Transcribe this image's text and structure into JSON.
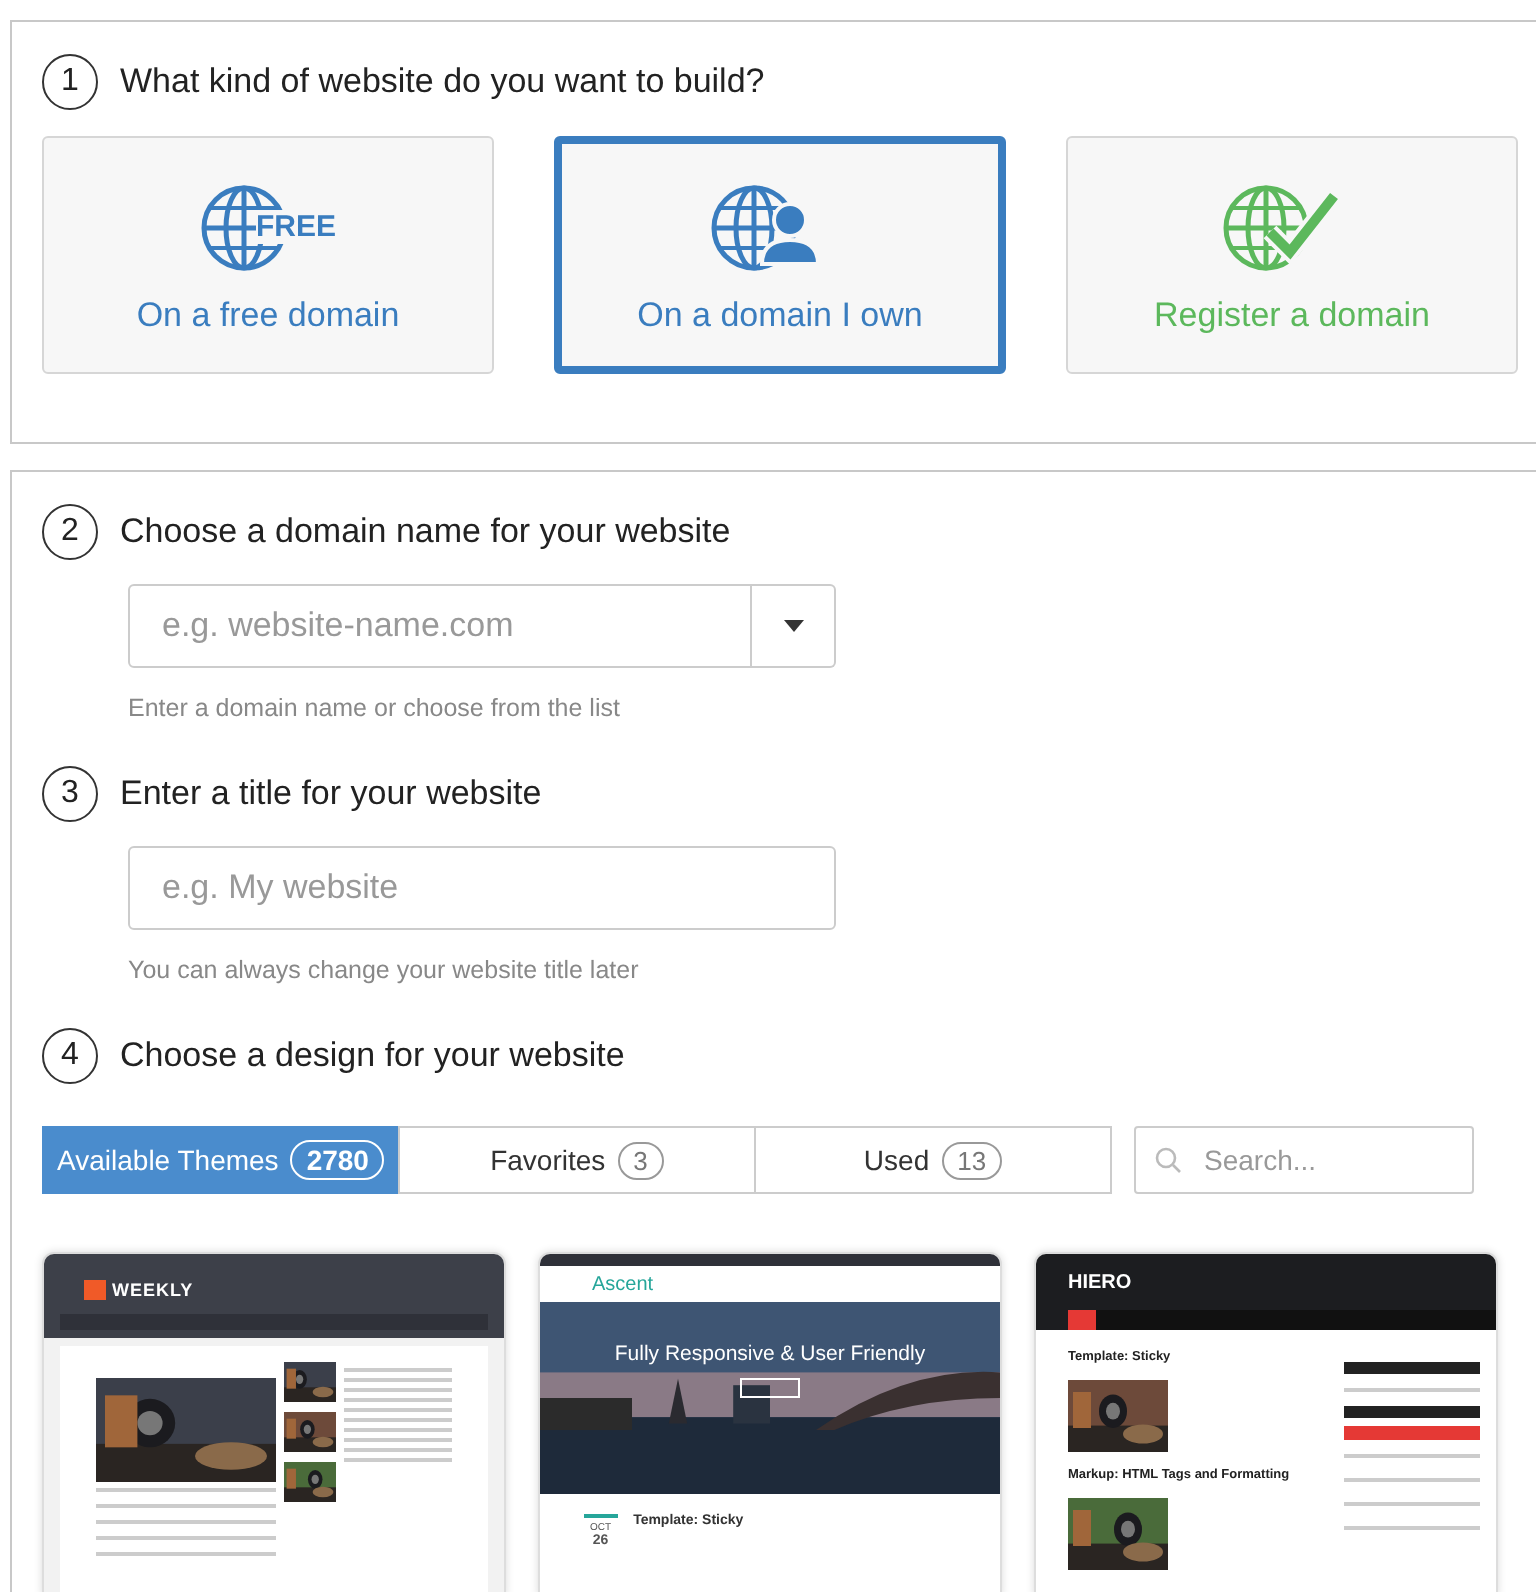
{
  "step1": {
    "number": "1",
    "title": "What kind of website do you want to build?",
    "options": [
      {
        "kind": "free",
        "label": "On a free domain",
        "icon_text": "FREE",
        "selected": false,
        "color": "#3a7dbf"
      },
      {
        "kind": "own",
        "label": "On a domain I own",
        "selected": true,
        "color": "#3a7dbf"
      },
      {
        "kind": "register",
        "label": "Register a domain",
        "selected": false,
        "color": "#5cb85c"
      }
    ]
  },
  "step2": {
    "number": "2",
    "title": "Choose a domain name for your website",
    "placeholder": "e.g. website-name.com",
    "hint": "Enter a domain name or choose from the list"
  },
  "step3": {
    "number": "3",
    "title": "Enter a title for your website",
    "placeholder": "e.g. My website",
    "hint": "You can always change your website title later"
  },
  "step4": {
    "number": "4",
    "title": "Choose a design for your website",
    "tabs": [
      {
        "label": "Available Themes",
        "count": "2780",
        "selected": true
      },
      {
        "label": "Favorites",
        "count": "3",
        "selected": false
      },
      {
        "label": "Used",
        "count": "13",
        "selected": false
      }
    ],
    "search": {
      "placeholder": "Search..."
    },
    "themes": [
      {
        "kind": "magazine",
        "logo": "WEEKLY"
      },
      {
        "kind": "hero",
        "logo": "Ascent",
        "headline": "Fully Responsive & User Friendly",
        "month": "OCT",
        "day": "26",
        "post": "Template: Sticky"
      },
      {
        "kind": "blog",
        "logo": "HIERO",
        "posts": [
          "Template: Sticky",
          "Markup: HTML Tags and Formatting"
        ]
      }
    ]
  }
}
